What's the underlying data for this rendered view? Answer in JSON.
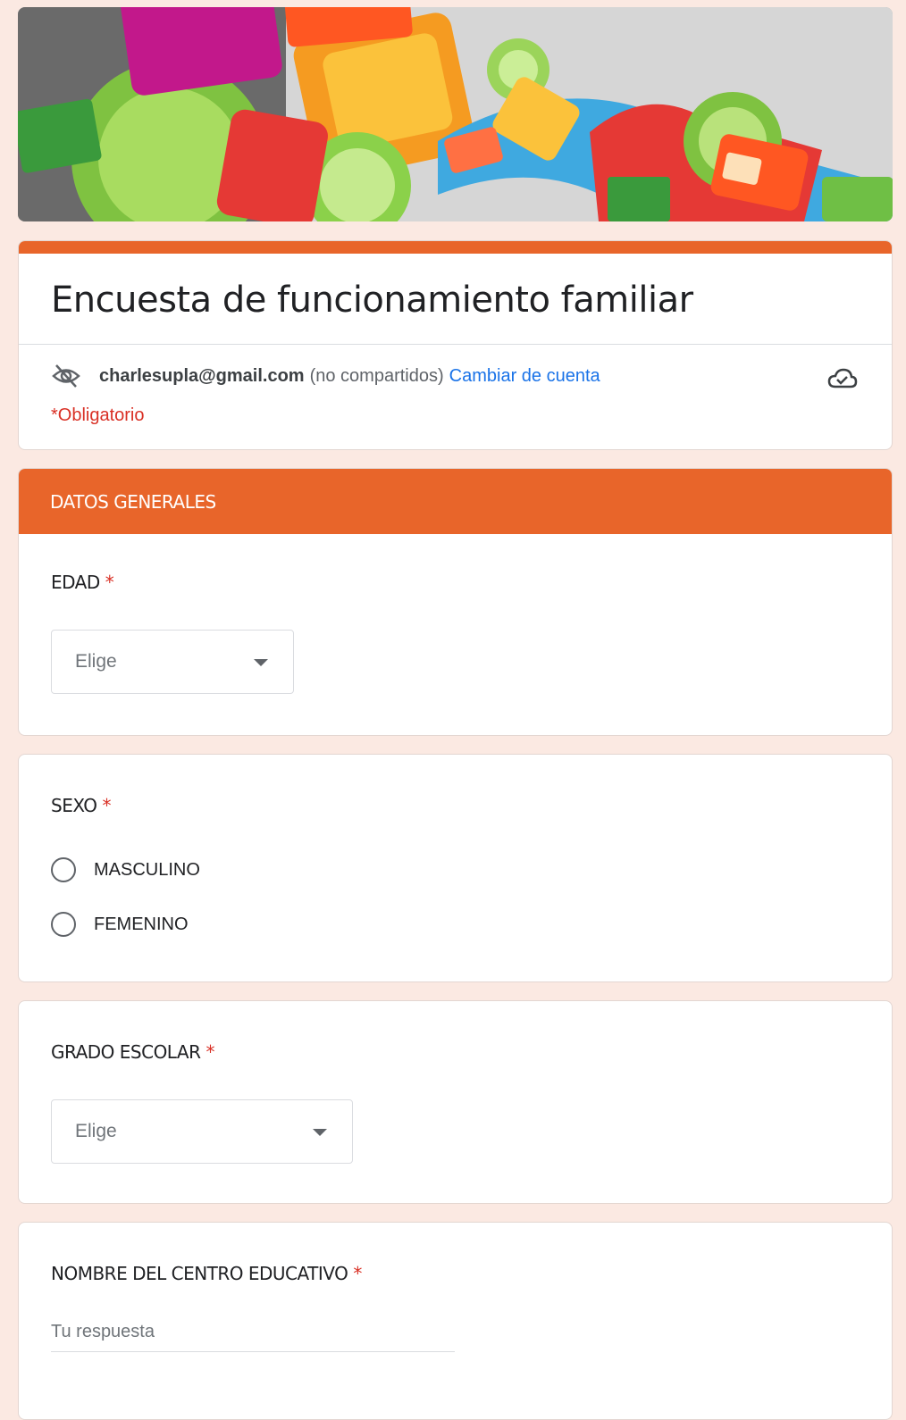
{
  "form": {
    "title": "Encuesta de funcionamiento familiar",
    "account_email": "charlesupla@gmail.com",
    "not_shared": "(no compartidos)",
    "switch_account": "Cambiar de cuenta",
    "required_note": "*Obligatorio"
  },
  "section": {
    "title": "DATOS GENERALES"
  },
  "questions": {
    "edad": {
      "label": "EDAD",
      "required_mark": "*",
      "select_value": "Elige"
    },
    "sexo": {
      "label": "SEXO",
      "required_mark": "*",
      "options": [
        "MASCULINO",
        "FEMENINO"
      ]
    },
    "grado": {
      "label": "GRADO ESCOLAR",
      "required_mark": "*",
      "select_value": "Elige"
    },
    "centro": {
      "label": "NOMBRE DEL CENTRO EDUCATIVO",
      "required_mark": "*",
      "placeholder": "Tu respuesta"
    }
  },
  "colors": {
    "accent": "#e8652a",
    "page_bg": "#fbe9e2",
    "link": "#1a73e8",
    "required": "#d93025"
  },
  "icons": {
    "visibility": "eye-off-icon",
    "cloud": "cloud-done-icon",
    "dropdown": "arrow-drop-down-icon"
  }
}
